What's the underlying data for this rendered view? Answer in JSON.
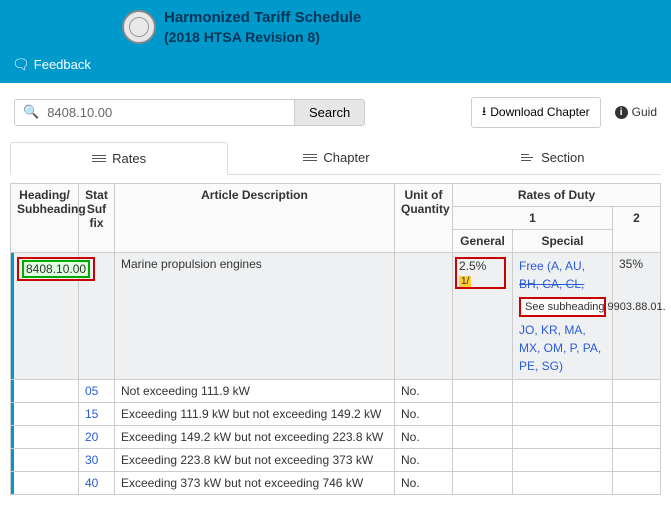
{
  "header": {
    "title_line1": "Harmonized Tariff Schedule",
    "title_line2": "(2018 HTSA Revision 8)",
    "feedback_label": "Feedback"
  },
  "toolbar": {
    "search_value": "8408.10.00",
    "search_button": "Search",
    "download_label": "Download Chapter",
    "guide_label": "Guid"
  },
  "tabs": {
    "rates": "Rates",
    "chapter": "Chapter",
    "section": "Section"
  },
  "table": {
    "headers": {
      "heading": "Heading/ Subheading",
      "suffix": "Stat Suf fix",
      "description": "Article Description",
      "unit": "Unit of Quantity",
      "rates_group": "Rates of Duty",
      "col1": "1",
      "general": "General",
      "special": "Special",
      "col2": "2"
    },
    "main_row": {
      "heading": "8408.10.00",
      "description": "Marine propulsion engines",
      "general": "2.5%",
      "general_flag": "1/",
      "special_line1": "Free (A, AU,",
      "special_line2_struck": "BH, CA, CL,",
      "subheading_note": "See subheading 9903.88.01.",
      "special_line3": "JO, KR, MA,",
      "special_line4": "MX, OM, P, PA,",
      "special_line5": "PE, SG)",
      "col2": "35%"
    },
    "sub_rows": [
      {
        "suffix": "05",
        "description": "Not exceeding 111.9 kW",
        "unit": "No."
      },
      {
        "suffix": "15",
        "description": "Exceeding 111.9 kW but not exceeding 149.2 kW",
        "unit": "No."
      },
      {
        "suffix": "20",
        "description": "Exceeding 149.2 kW but not exceeding 223.8 kW",
        "unit": "No."
      },
      {
        "suffix": "30",
        "description": "Exceeding 223.8 kW but not exceeding 373 kW",
        "unit": "No."
      },
      {
        "suffix": "40",
        "description": "Exceeding 373 kW but not exceeding 746 kW",
        "unit": "No."
      }
    ]
  }
}
